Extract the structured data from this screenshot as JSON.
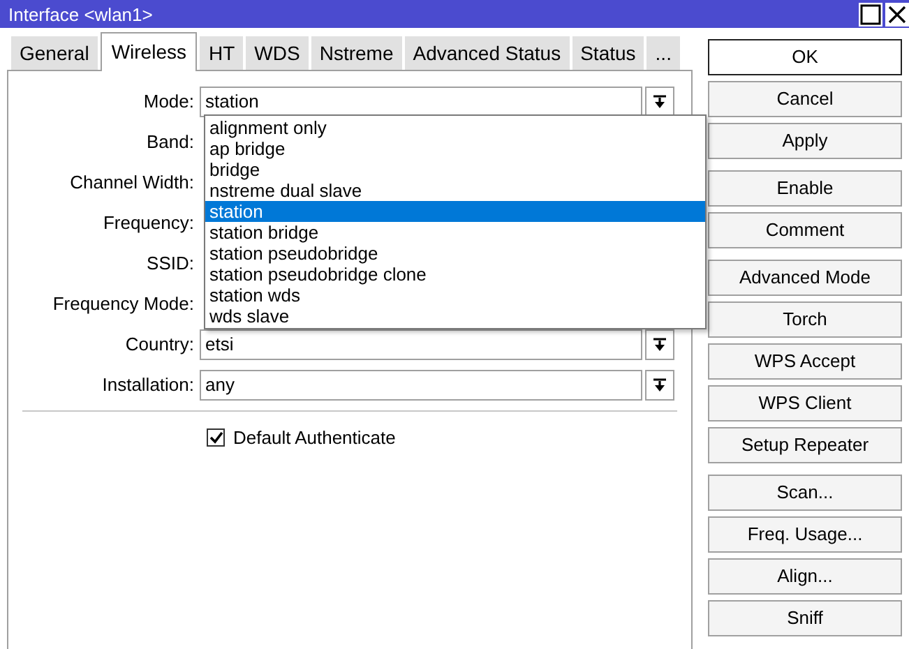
{
  "window": {
    "title": "Interface <wlan1>"
  },
  "tabs": [
    {
      "label": "General",
      "selected": false
    },
    {
      "label": "Wireless",
      "selected": true
    },
    {
      "label": "HT",
      "selected": false
    },
    {
      "label": "WDS",
      "selected": false
    },
    {
      "label": "Nstreme",
      "selected": false
    },
    {
      "label": "Advanced Status",
      "selected": false
    },
    {
      "label": "Status",
      "selected": false
    },
    {
      "label": "...",
      "selected": false
    }
  ],
  "fields": [
    {
      "label": "Mode:",
      "value": "station"
    },
    {
      "label": "Band:"
    },
    {
      "label": "Channel Width:"
    },
    {
      "label": "Frequency:"
    },
    {
      "label": "SSID:"
    },
    {
      "label": "Frequency Mode:"
    },
    {
      "label": "Country:",
      "value": "etsi"
    },
    {
      "label": "Installation:",
      "value": "any"
    }
  ],
  "dropdown": {
    "options": [
      {
        "label": "alignment only",
        "selected": false
      },
      {
        "label": "ap bridge",
        "selected": false
      },
      {
        "label": "bridge",
        "selected": false
      },
      {
        "label": "nstreme dual slave",
        "selected": false
      },
      {
        "label": "station",
        "selected": true
      },
      {
        "label": "station bridge",
        "selected": false
      },
      {
        "label": "station pseudobridge",
        "selected": false
      },
      {
        "label": "station pseudobridge clone",
        "selected": false
      },
      {
        "label": "station wds",
        "selected": false
      },
      {
        "label": "wds slave",
        "selected": false
      }
    ]
  },
  "checkbox": {
    "label": "Default Authenticate",
    "checked": true
  },
  "button_groups": [
    [
      {
        "label": "OK",
        "default": true
      },
      {
        "label": "Cancel",
        "default": false
      },
      {
        "label": "Apply",
        "default": false
      }
    ],
    [
      {
        "label": "Enable",
        "default": false
      },
      {
        "label": "Comment",
        "default": false
      }
    ],
    [
      {
        "label": "Advanced Mode",
        "default": false
      },
      {
        "label": "Torch",
        "default": false
      },
      {
        "label": "WPS Accept",
        "default": false
      },
      {
        "label": "WPS Client",
        "default": false
      },
      {
        "label": "Setup Repeater",
        "default": false
      }
    ],
    [
      {
        "label": "Scan...",
        "default": false
      },
      {
        "label": "Freq. Usage...",
        "default": false
      },
      {
        "label": "Align...",
        "default": false
      },
      {
        "label": "Sniff",
        "default": false
      }
    ]
  ]
}
